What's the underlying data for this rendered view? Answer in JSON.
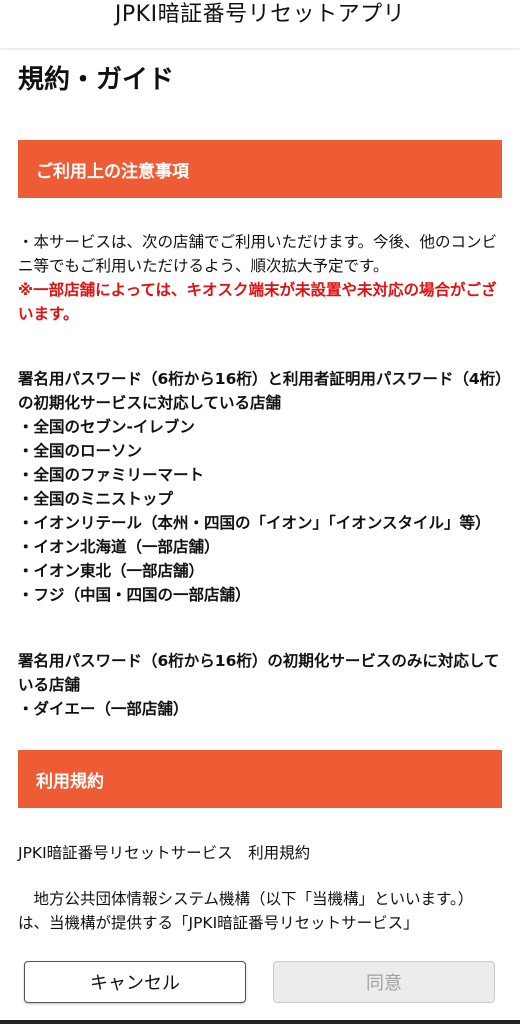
{
  "header": {
    "title": "JPKI暗証番号リセットアプリ"
  },
  "page": {
    "title": "規約・ガイド"
  },
  "notice_section": {
    "heading": "ご利用上の注意事項",
    "intro": "・本サービスは、次の店舗でご利用いただけます。今後、他のコンビニ等でもご利用いただけるよう、順次拡大予定です。",
    "warning": "※一部店舗によっては、キオスク端末が未設置や未対応の場合がございます。",
    "group1_title": "署名用パスワード（6桁から16桁）と利用者証明用パスワード（4桁）の初期化サービスに対応している店舗",
    "group1_stores": [
      "・全国のセブン-イレブン",
      "・全国のローソン",
      "・全国のファミリーマート",
      "・全国のミニストップ",
      "・イオンリテール（本州・四国の「イオン」「イオンスタイル」等）",
      "・イオン北海道（一部店舗）",
      "・イオン東北（一部店舗）",
      "・フジ（中国・四国の一部店舗）"
    ],
    "group2_title": "署名用パスワード（6桁から16桁）の初期化サービスのみに対応している店舗",
    "group2_stores": [
      "・ダイエー（一部店舗）"
    ]
  },
  "terms_section": {
    "heading": "利用規約",
    "doc_title": "JPKI暗証番号リセットサービス　利用規約",
    "paragraph": "　地方公共団体情報システム機構（以下「当機構」といいます。）は、当機構が提供する「JPKI暗証番号リセットサービス」"
  },
  "footer": {
    "cancel_label": "キャンセル",
    "agree_label": "同意"
  }
}
